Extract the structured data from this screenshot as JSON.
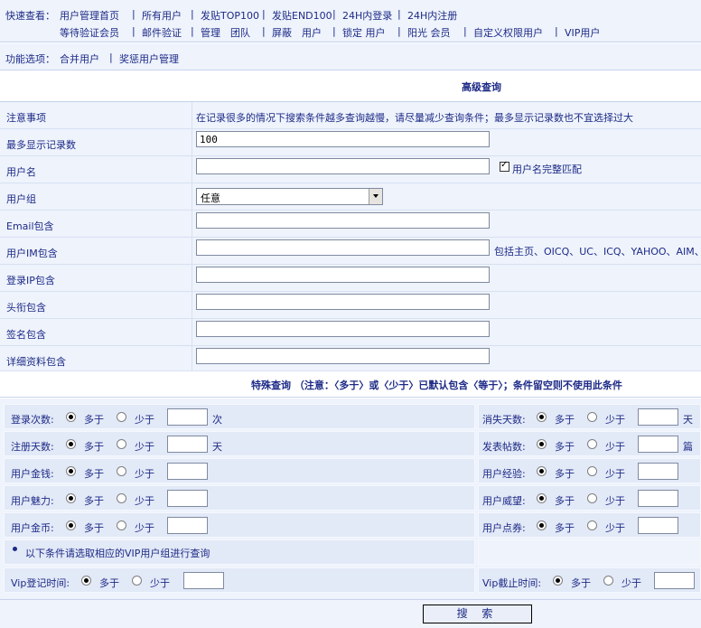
{
  "nav": {
    "prefix": "快速查看：",
    "row1": [
      "用户管理首页",
      "所有用户",
      "发贴TOP100",
      "发贴END100",
      "24H内登录",
      "24H内注册"
    ],
    "row2": [
      "等待验证会员",
      "邮件验证",
      "管理　团队",
      "屏蔽　用户",
      "锁定 用户",
      "阳光 会员",
      "自定义权限用户",
      "VIP用户"
    ],
    "sep": "|"
  },
  "func": {
    "prefix": "功能选项：",
    "items": [
      "合并用户",
      "奖惩用户管理"
    ]
  },
  "adv": {
    "title": "高级查询",
    "rows": [
      {
        "label": "注意事项",
        "note": "在记录很多的情况下搜索条件越多查询越慢，请尽量减少查询条件；最多显示记录数也不宜选择过大"
      },
      {
        "label": "最多显示记录数",
        "value": "100"
      },
      {
        "label": "用户名",
        "value": "",
        "check_label": "用户名完整匹配",
        "checked": true
      },
      {
        "label": "用户组",
        "select_value": "任意"
      },
      {
        "label": "Email包含",
        "value": ""
      },
      {
        "label": "用户IM包含",
        "value": "",
        "hint": "包括主页、OICQ、UC、ICQ、YAHOO、AIM、M"
      },
      {
        "label": "登录IP包含",
        "value": ""
      },
      {
        "label": "头衔包含",
        "value": ""
      },
      {
        "label": "签名包含",
        "value": ""
      },
      {
        "label": "详细资料包含",
        "value": ""
      }
    ]
  },
  "special": {
    "title": "特殊查询 （注意：〈多于〉或〈少于〉已默认包含〈等于〉；条件留空则不使用此条件",
    "more": "多于",
    "less": "少于",
    "left": [
      {
        "label": "登录次数:",
        "unit": "次"
      },
      {
        "label": "注册天数:",
        "unit": "天"
      },
      {
        "label": "用户金钱:",
        "unit": ""
      },
      {
        "label": "用户魅力:",
        "unit": ""
      },
      {
        "label": "用户金币:",
        "unit": ""
      }
    ],
    "right": [
      {
        "label": "消失天数:",
        "unit": "天"
      },
      {
        "label": "发表帖数:",
        "unit": "篇"
      },
      {
        "label": "用户经验:",
        "unit": ""
      },
      {
        "label": "用户威望:",
        "unit": ""
      },
      {
        "label": "用户点券:",
        "unit": ""
      }
    ],
    "vip_note": "以下条件请选取相应的VIP用户组进行查询",
    "vip_left": "Vip登记时间:",
    "vip_right": "Vip截止时间:"
  },
  "submit_label": "搜 索",
  "colors": {
    "panel": "#eef3fc",
    "cell": "#e2e9f7",
    "text": "#1d2a86",
    "border": "#c7d3ec"
  }
}
